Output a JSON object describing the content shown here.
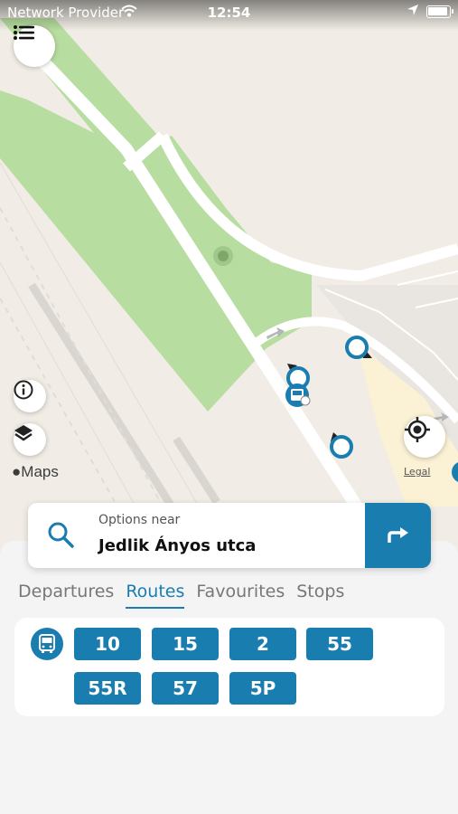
{
  "status_bar": {
    "carrier": "Network Provider",
    "time": "12:54",
    "icons": [
      "wifi-icon",
      "location-arrow-icon",
      "battery-icon"
    ]
  },
  "map": {
    "attribution": "Maps",
    "legal": "Legal",
    "controls": [
      "list-icon",
      "info-icon",
      "layers-icon",
      "locate-icon"
    ]
  },
  "search": {
    "label": "Options near",
    "place": "Jedlik Ányos utca",
    "icon": "search-icon",
    "action_icon": "directions-icon"
  },
  "tabs": [
    {
      "label": "Departures",
      "active": false
    },
    {
      "label": "Routes",
      "active": true
    },
    {
      "label": "Favourites",
      "active": false
    },
    {
      "label": "Stops",
      "active": false
    }
  ],
  "routes": {
    "mode_icon": "bus-icon",
    "items": [
      "10",
      "15",
      "2",
      "55",
      "55R",
      "57",
      "5P"
    ]
  },
  "colors": {
    "accent": "#1a7db0",
    "park": "#b8dda0",
    "map_background": "#f1ede6"
  }
}
